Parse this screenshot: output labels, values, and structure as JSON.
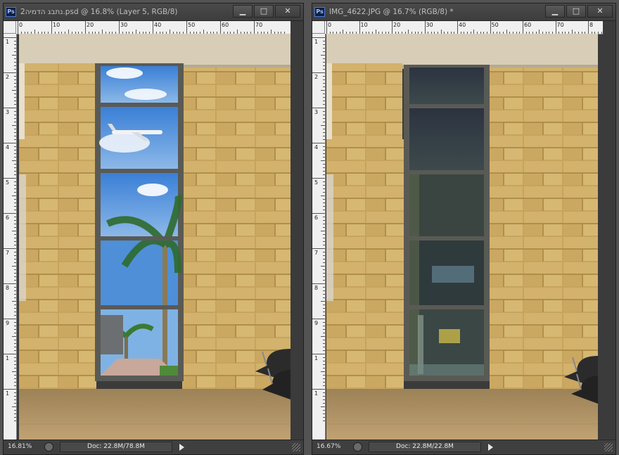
{
  "colors": {
    "stone": "#c9a760",
    "floor": "#b49261",
    "frame": "#5a5a55",
    "sky": "#2f73c8"
  },
  "windows": [
    {
      "title": "2נתבג הדמיה.psd @ 16.8% (Layer 5, RGB/8)",
      "zoom": "16.81%",
      "doc": "Doc: 22.8M/78.8M",
      "hruler_labels": [
        "0",
        "10",
        "20",
        "30",
        "40",
        "50",
        "60",
        "70"
      ],
      "vruler_labels": [
        "1",
        "2",
        "3",
        "4",
        "5",
        "6",
        "7",
        "8",
        "9",
        "1",
        "1"
      ],
      "icons": [
        "photoshop-icon",
        "minimize-icon",
        "maximize-icon",
        "close-icon"
      ]
    },
    {
      "title": "IMG_4622.JPG @ 16.7% (RGB/8) *",
      "zoom": "16.67%",
      "doc": "Doc: 22.8M/22.8M",
      "hruler_labels": [
        "0",
        "10",
        "20",
        "30",
        "40",
        "50",
        "60",
        "70",
        "8"
      ],
      "vruler_labels": [
        "1",
        "2",
        "3",
        "4",
        "5",
        "6",
        "7",
        "8",
        "9",
        "1",
        "1"
      ],
      "icons": [
        "photoshop-icon",
        "minimize-icon",
        "maximize-icon",
        "close-icon"
      ]
    }
  ],
  "controls": {
    "minimize": "▁",
    "maximize": "□",
    "close": "✕"
  },
  "ps_badge": "Ps"
}
